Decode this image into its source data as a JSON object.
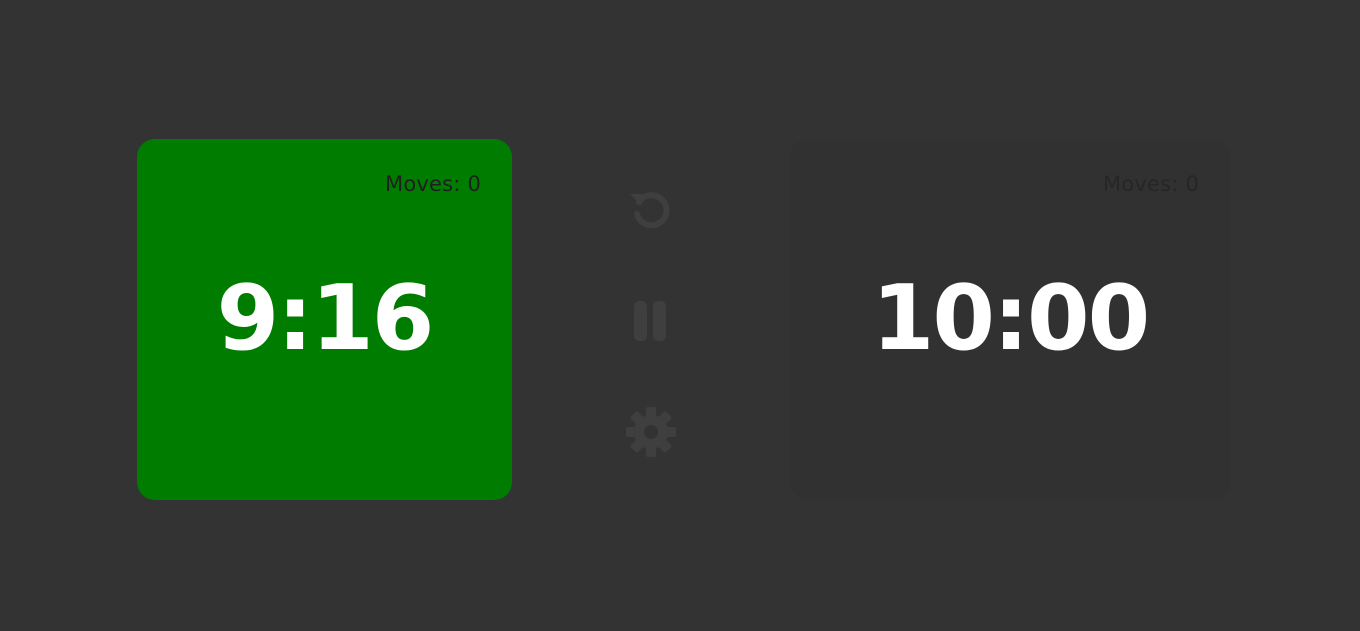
{
  "players": {
    "left": {
      "time": "9:16",
      "moves_label": "Moves:",
      "moves_value": "0",
      "active": true,
      "color": "#007d00"
    },
    "right": {
      "time": "10:00",
      "moves_label": "Moves:",
      "moves_value": "0",
      "active": false,
      "color": "#313131"
    }
  },
  "controls": [
    {
      "icon": "reset-icon"
    },
    {
      "icon": "pause-icon"
    },
    {
      "icon": "gear-icon"
    }
  ],
  "colors": {
    "background": "#333333",
    "icon": "#3f3f3f",
    "text": "#ffffff"
  }
}
